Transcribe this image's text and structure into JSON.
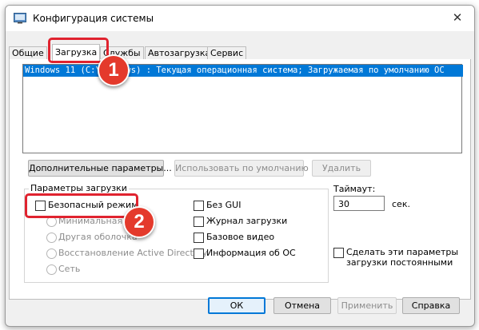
{
  "window": {
    "title": "Конфигурация системы",
    "close_glyph": "✕"
  },
  "tabs": [
    {
      "label": "Общие"
    },
    {
      "label": "Загрузка",
      "active": true
    },
    {
      "label": "Службы"
    },
    {
      "label": "Автозагрузка"
    },
    {
      "label": "Сервис"
    }
  ],
  "os_list": {
    "selected_entry": "Windows 11 (C:\\Windows) : Текущая операционная система; Загружаемая по умолчанию ОС"
  },
  "buttons": {
    "advanced": "Дополнительные параметры...",
    "set_default": "Использовать по умолчанию",
    "delete": "Удалить"
  },
  "boot_options": {
    "group_title": "Параметры загрузки",
    "safe_boot": {
      "label": "Безопасный режим",
      "checked": false
    },
    "radios": [
      "Минимальная",
      "Другая оболочка",
      "Восстановление Active Directory",
      "Сеть"
    ],
    "right_checks": [
      {
        "label": "Без GUI",
        "checked": false
      },
      {
        "label": "Журнал загрузки",
        "checked": false
      },
      {
        "label": "Базовое видео",
        "checked": false
      },
      {
        "label": "Информация об ОС",
        "checked": false
      }
    ]
  },
  "timeout": {
    "label": "Таймаут:",
    "value": "30",
    "unit": "сек."
  },
  "persistent": {
    "label_line1": "Сделать эти параметры",
    "label_line2": "загрузки постоянными",
    "checked": false
  },
  "footer": {
    "ok": "ОК",
    "cancel": "Отмена",
    "apply": "Применить",
    "help": "Справка"
  },
  "annotations": {
    "step1": "1",
    "step2": "2",
    "highlight_color": "#e0232f",
    "badge_color": "#e43a2c"
  }
}
